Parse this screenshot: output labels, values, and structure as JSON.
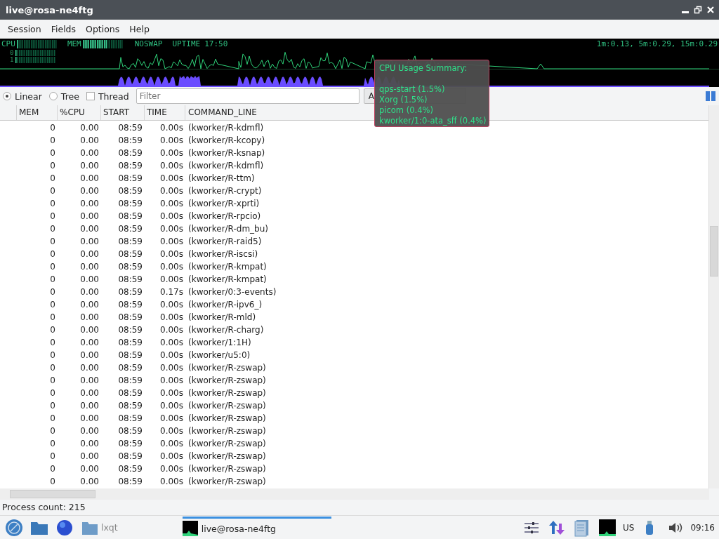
{
  "window": {
    "title": "live@rosa-ne4ftg"
  },
  "menu": [
    "Session",
    "Fields",
    "Options",
    "Help"
  ],
  "meters": {
    "cpu_label": "CPU",
    "cpu_rows": [
      "0",
      "1"
    ],
    "mem_label": "MEM",
    "swap_label": "NOSWAP",
    "uptime_label": "UPTIME",
    "uptime": "17:50",
    "load": "1m:0.13, 5m:0.29, 15m:0.29"
  },
  "view_modes": [
    {
      "label": "Linear",
      "selected": true
    },
    {
      "label": "Tree",
      "selected": false
    }
  ],
  "thread": {
    "label": "Thread",
    "checked": false
  },
  "filter": {
    "placeholder": "Filter"
  },
  "process_filter": {
    "value": "A"
  },
  "tooltip": {
    "title": "CPU Usage Summary:",
    "lines": [
      "qps-start (1.5%)",
      "Xorg (1.5%)",
      "picom (0.4%)",
      "kworker/1:0-ata_sff (0.4%)"
    ]
  },
  "table": {
    "columns": [
      "",
      "MEM",
      "%CPU",
      "START",
      "TIME",
      "COMMAND_LINE"
    ],
    "rows": [
      [
        "0",
        "0.00",
        "08:59",
        "0.00s",
        "(kworker/R-kdmfl)"
      ],
      [
        "0",
        "0.00",
        "08:59",
        "0.00s",
        "(kworker/R-kcopy)"
      ],
      [
        "0",
        "0.00",
        "08:59",
        "0.00s",
        "(kworker/R-ksnap)"
      ],
      [
        "0",
        "0.00",
        "08:59",
        "0.00s",
        "(kworker/R-kdmfl)"
      ],
      [
        "0",
        "0.00",
        "08:59",
        "0.00s",
        "(kworker/R-ttm)"
      ],
      [
        "0",
        "0.00",
        "08:59",
        "0.00s",
        "(kworker/R-crypt)"
      ],
      [
        "0",
        "0.00",
        "08:59",
        "0.00s",
        "(kworker/R-xprti)"
      ],
      [
        "0",
        "0.00",
        "08:59",
        "0.00s",
        "(kworker/R-rpcio)"
      ],
      [
        "0",
        "0.00",
        "08:59",
        "0.00s",
        "(kworker/R-dm_bu)"
      ],
      [
        "0",
        "0.00",
        "08:59",
        "0.00s",
        "(kworker/R-raid5)"
      ],
      [
        "0",
        "0.00",
        "08:59",
        "0.00s",
        "(kworker/R-iscsi)"
      ],
      [
        "0",
        "0.00",
        "08:59",
        "0.00s",
        "(kworker/R-kmpat)"
      ],
      [
        "0",
        "0.00",
        "08:59",
        "0.00s",
        "(kworker/R-kmpat)"
      ],
      [
        "0",
        "0.00",
        "08:59",
        "0.17s",
        "(kworker/0:3-events)"
      ],
      [
        "0",
        "0.00",
        "08:59",
        "0.00s",
        "(kworker/R-ipv6_)"
      ],
      [
        "0",
        "0.00",
        "08:59",
        "0.00s",
        "(kworker/R-mld)"
      ],
      [
        "0",
        "0.00",
        "08:59",
        "0.00s",
        "(kworker/R-charg)"
      ],
      [
        "0",
        "0.00",
        "08:59",
        "0.00s",
        "(kworker/1:1H)"
      ],
      [
        "0",
        "0.00",
        "08:59",
        "0.00s",
        "(kworker/u5:0)"
      ],
      [
        "0",
        "0.00",
        "08:59",
        "0.00s",
        "(kworker/R-zswap)"
      ],
      [
        "0",
        "0.00",
        "08:59",
        "0.00s",
        "(kworker/R-zswap)"
      ],
      [
        "0",
        "0.00",
        "08:59",
        "0.00s",
        "(kworker/R-zswap)"
      ],
      [
        "0",
        "0.00",
        "08:59",
        "0.00s",
        "(kworker/R-zswap)"
      ],
      [
        "0",
        "0.00",
        "08:59",
        "0.00s",
        "(kworker/R-zswap)"
      ],
      [
        "0",
        "0.00",
        "08:59",
        "0.00s",
        "(kworker/R-zswap)"
      ],
      [
        "0",
        "0.00",
        "08:59",
        "0.00s",
        "(kworker/R-zswap)"
      ],
      [
        "0",
        "0.00",
        "08:59",
        "0.00s",
        "(kworker/R-zswap)"
      ],
      [
        "0",
        "0.00",
        "08:59",
        "0.00s",
        "(kworker/R-zswap)"
      ],
      [
        "0",
        "0.00",
        "08:59",
        "0.00s",
        "(kworker/R-zswap)"
      ]
    ]
  },
  "status_bar": {
    "text": "Process count: 215"
  },
  "taskbar": {
    "folder_label": "lxqt",
    "task": {
      "label": "live@rosa-ne4ftg",
      "selected": true
    },
    "keyboard": "US",
    "clock": "09:16"
  }
}
